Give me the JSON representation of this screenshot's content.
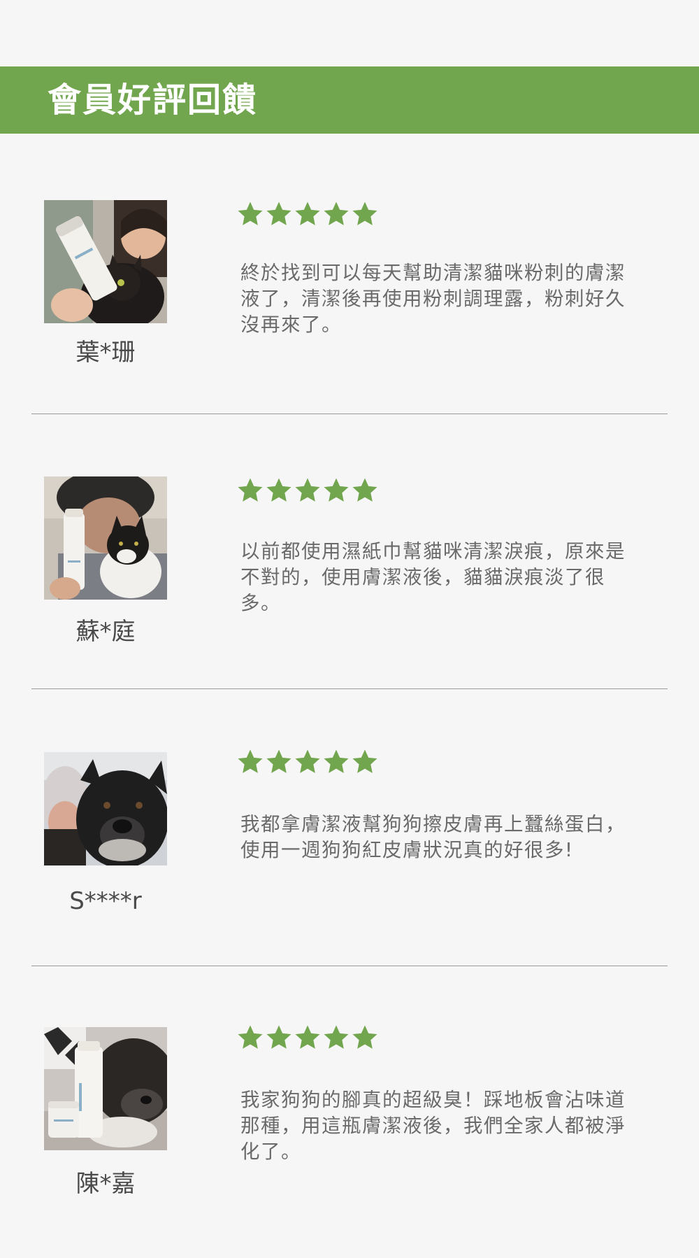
{
  "header": {
    "title": "會員好評回饋"
  },
  "colors": {
    "accent": "#72a64e",
    "star": "#72a64e",
    "background": "#f6f6f6",
    "divider": "#9a9a9a"
  },
  "reviews": [
    {
      "name": "葉*珊",
      "rating": 5,
      "text": "終於找到可以每天幫助清潔貓咪粉刺的膚潔液了，清潔後再使用粉刺調理露，粉刺好久沒再來了。",
      "photo_icon": "owner-with-cat-photo"
    },
    {
      "name": "蘇*庭",
      "rating": 5,
      "text": "以前都使用濕紙巾幫貓咪清潔淚痕，原來是不對的，使用膚潔液後，貓貓淚痕淡了很多。",
      "photo_icon": "owner-with-cat-photo"
    },
    {
      "name": "S****r",
      "rating": 5,
      "text": "我都拿膚潔液幫狗狗擦皮膚再上蠶絲蛋白，使用一週狗狗紅皮膚狀況真的好很多!",
      "photo_icon": "owner-with-dog-photo"
    },
    {
      "name": "陳*嘉",
      "rating": 5,
      "text": "我家狗狗的腳真的超級臭！踩地板會沾味道那種，用這瓶膚潔液後，我們全家人都被淨化了。",
      "photo_icon": "dog-with-products-photo"
    }
  ]
}
